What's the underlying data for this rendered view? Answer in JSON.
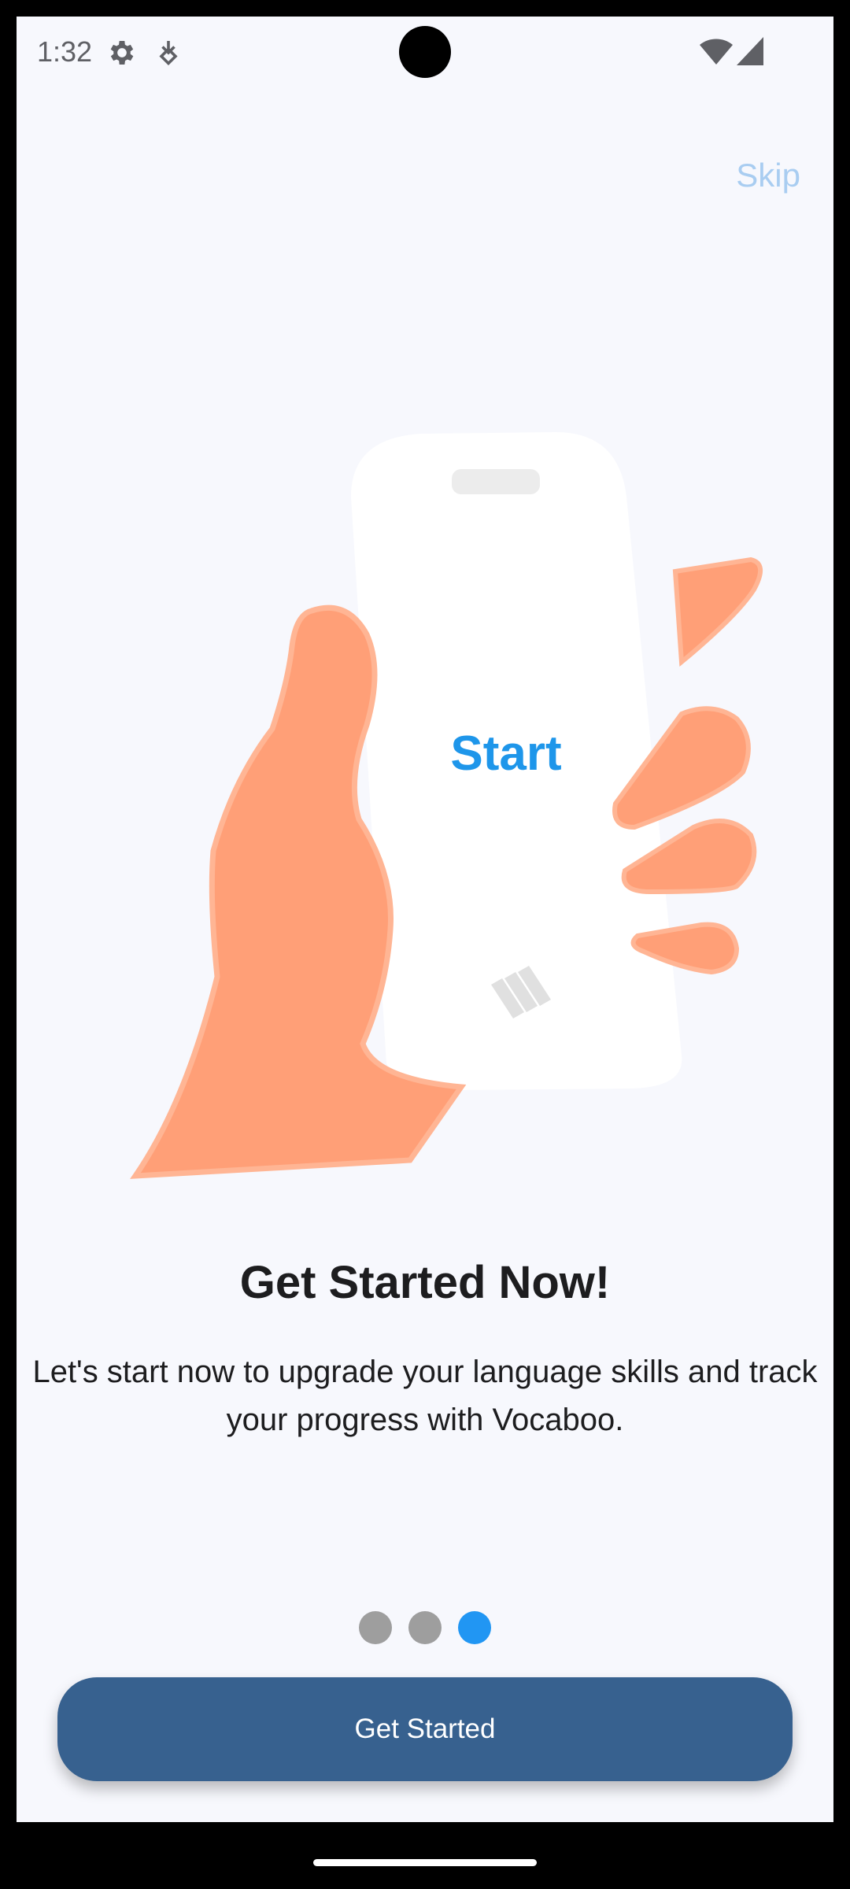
{
  "status_bar": {
    "time": "1:32",
    "icons": [
      "gear-icon",
      "download-icon",
      "wifi-icon",
      "signal-icon"
    ]
  },
  "onboarding": {
    "skip_label": "Skip",
    "phone_screen_text": "Start",
    "title": "Get Started Now!",
    "description": "Let's start now to upgrade your language skills and track your progress with Vocaboo.",
    "page_indicator": {
      "total": 3,
      "current": 3
    },
    "cta_label": "Get Started"
  },
  "colors": {
    "background": "#f7f8fd",
    "skip": "#a9cdf1",
    "accent_blue": "#2196f3",
    "phone_text": "#1e96ea",
    "hand": "#ff9f77",
    "cta": "#37618f",
    "dot_inactive": "#9e9e9e"
  }
}
